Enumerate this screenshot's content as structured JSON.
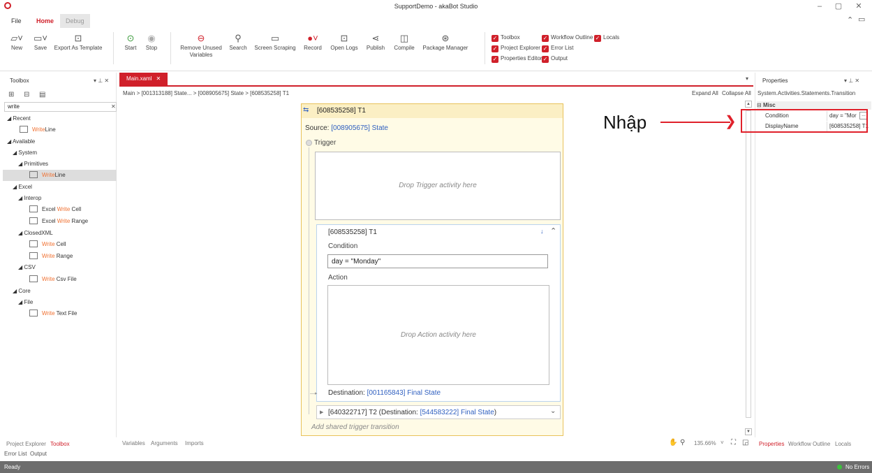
{
  "window": {
    "title": "SupportDemo - akaBot Studio"
  },
  "menu": {
    "file": "File",
    "home": "Home",
    "debug": "Debug"
  },
  "ribbon": {
    "buttons": [
      {
        "label": "New",
        "icon": "new-file-icon"
      },
      {
        "label": "Save",
        "icon": "save-icon"
      },
      {
        "label": "Export As Template",
        "icon": "export-icon"
      },
      {
        "label": "Start",
        "icon": "play-icon"
      },
      {
        "label": "Stop",
        "icon": "stop-icon"
      },
      {
        "label": "Remove Unused Variables",
        "icon": "remove-icon"
      },
      {
        "label": "Search",
        "icon": "search-icon"
      },
      {
        "label": "Screen Scraping",
        "icon": "screen-icon"
      },
      {
        "label": "Record",
        "icon": "record-icon"
      },
      {
        "label": "Open Logs",
        "icon": "logs-icon"
      },
      {
        "label": "Publish",
        "icon": "share-icon"
      },
      {
        "label": "Compile",
        "icon": "compile-icon"
      },
      {
        "label": "Package Manager",
        "icon": "package-icon"
      }
    ],
    "checks": [
      "Toolbox",
      "Project Explorer",
      "Properties Editor",
      "Workflow Outline",
      "Error List",
      "Output",
      "Locals"
    ]
  },
  "toolbox": {
    "title": "Toolbox",
    "search": "write",
    "recent": "Recent",
    "available": "Available",
    "system": "System",
    "primitives": "Primitives",
    "excel": "Excel",
    "interop": "Interop",
    "closedxml": "ClosedXML",
    "csv": "CSV",
    "core": "Core",
    "file": "File",
    "items": {
      "recent_write": "Write",
      "recent_line": "Line",
      "prim_write": "Write",
      "prim_line": "Line",
      "ew_excel": "Excel ",
      "ew_write": "Write",
      "ew_cell": " Cell",
      "ewr_excel": "Excel ",
      "ewr_write": "Write",
      "ewr_range": " Range",
      "wc_write": "Write",
      "wc_cell": " Cell",
      "wr_write": "Write",
      "wr_range": " Range",
      "csv_write": "Write",
      "csv_file": " Csv File",
      "tf_write": "Write",
      "tf_file": " Text File"
    }
  },
  "document": {
    "tab": "Main.xaml",
    "breadcrumb": "Main  >  [001313188] State...  >  [008905675] State  >  [608535258] T1",
    "expand_all": "Expand All",
    "collapse_all": "Collapse All"
  },
  "designer": {
    "title": "[608535258] T1",
    "source_label": "Source: ",
    "source_value": "[008905675] State",
    "trigger": "Trigger",
    "drop_trigger": "Drop Trigger activity here",
    "inner_title": "[608535258] T1",
    "condition_label": "Condition",
    "condition_value": "day = \"Monday\"",
    "action_label": "Action",
    "drop_action": "Drop Action activity here",
    "destination_label": "Destination: ",
    "destination_value": "[001165843] Final State",
    "t2_label": "[640322717] T2 (Destination: ",
    "t2_value": "[544583222] Final State",
    "t2_close": ")",
    "add_shared": "Add shared trigger transition"
  },
  "bottom_tabs": {
    "left": [
      "Project Explorer",
      "Toolbox"
    ],
    "center": [
      "Variables",
      "Arguments",
      "Imports"
    ],
    "zoom": "135.66%",
    "right": [
      "Properties",
      "Workflow Outline",
      "Locals"
    ],
    "lower": [
      "Error List",
      "Output"
    ]
  },
  "properties": {
    "title": "Properties",
    "type": "System.Activities.Statements.Transition",
    "category": "Misc",
    "rows": [
      {
        "name": "Condition",
        "value": "day = \"Mor"
      },
      {
        "name": "DisplayName",
        "value": "[608535258] T1"
      }
    ]
  },
  "annotation": {
    "text": "Nhập"
  },
  "status": {
    "left": "Ready",
    "right": "No Errors"
  },
  "colors": {
    "accent": "#d0202a",
    "link": "#3060c0",
    "highlight": "#f07030"
  }
}
